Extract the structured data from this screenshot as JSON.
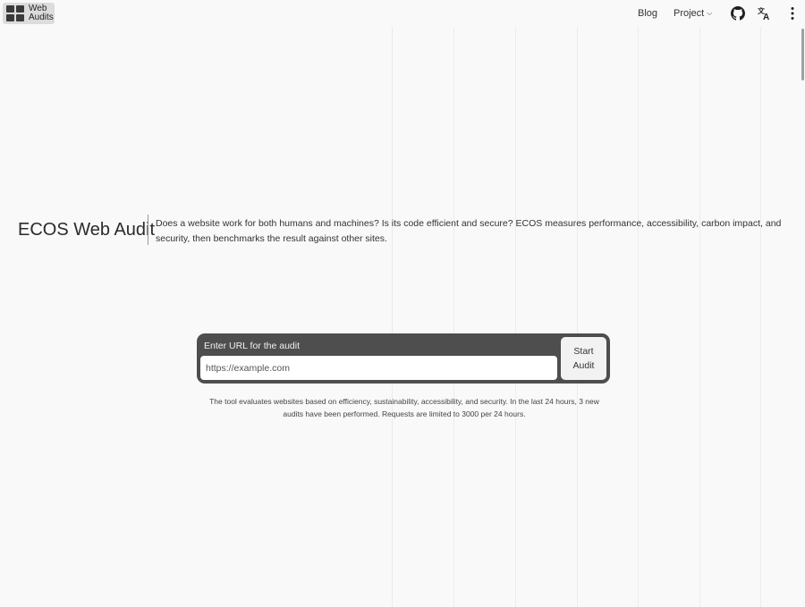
{
  "header": {
    "logo_text": "Web\nAudits",
    "nav": {
      "blog": "Blog",
      "project": "Project"
    },
    "icons": {
      "github": "github-icon",
      "translate": "translate-icon",
      "more": "more-vertical-icon",
      "project_chevron": "chevron-down-icon"
    }
  },
  "hero": {
    "title": "ECOS Web Audit",
    "description": "Does a website work for both humans and machines? Is its code efficient and secure? ECOS measures performance, accessibility, carbon impact, and security, then benchmarks the result against other sites."
  },
  "audit_form": {
    "label": "Enter URL for the audit",
    "placeholder": "https://example.com",
    "button_label": "Start\nAudit"
  },
  "note": "The tool evaluates websites based on efficiency, sustainability, accessibility, and security. In the last 24 hours, 3 new audits have been performed. Requests are limited to 3000 per 24 hours.",
  "colors": {
    "background": "#f9f9f9",
    "form_background": "#4e4e4e",
    "button_background": "#f2f2f2"
  }
}
